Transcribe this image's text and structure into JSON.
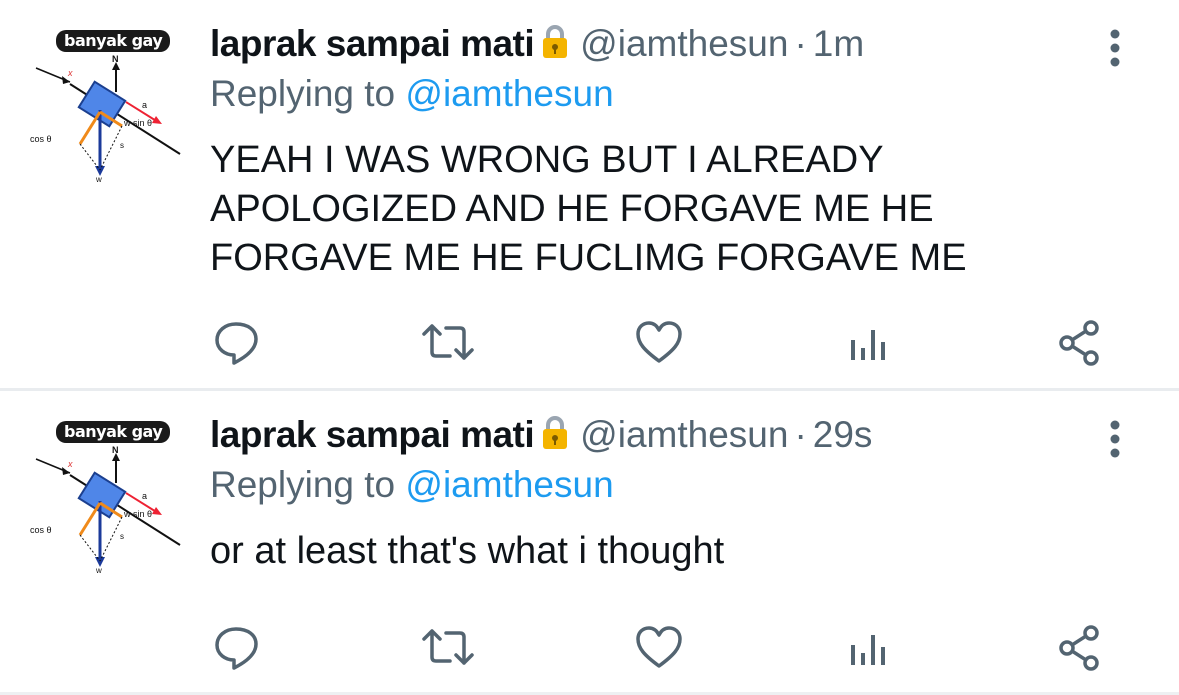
{
  "colors": {
    "text": "#0f1419",
    "muted": "#536471",
    "link": "#1d9bf0",
    "icon": "#536471",
    "lock": "#f4b400"
  },
  "tweets": [
    {
      "avatar_text": "banyak gay",
      "avatar_labels": {
        "n": "N",
        "x": "x",
        "a": "a",
        "wsin": "w sin θ",
        "cos": "cos θ",
        "s": "s",
        "w": "w"
      },
      "display_name": "laprak sampai mati",
      "handle": "@iamthesun",
      "separator": "·",
      "time": "1m",
      "replying_prefix": "Replying to",
      "replying_to": "@iamthesun",
      "text_lines": [
        "YEAH I WAS WRONG BUT I ALREADY",
        "APOLOGIZED AND HE FORGAVE ME HE",
        "FORGAVE ME HE FUCLIMG FORGAVE ME"
      ],
      "icons": [
        "reply-icon",
        "retweet-icon",
        "like-icon",
        "views-icon",
        "share-icon"
      ]
    },
    {
      "avatar_text": "banyak gay",
      "avatar_labels": {
        "n": "N",
        "x": "x",
        "a": "a",
        "wsin": "w sin θ",
        "cos": "cos θ",
        "s": "s",
        "w": "w"
      },
      "display_name": "laprak sampai mati",
      "handle": "@iamthesun",
      "separator": "·",
      "time": "29s",
      "replying_prefix": "Replying to",
      "replying_to": "@iamthesun",
      "text_lines": [
        "or at least that's what i thought"
      ],
      "icons": [
        "reply-icon",
        "retweet-icon",
        "like-icon",
        "views-icon",
        "share-icon"
      ]
    }
  ]
}
